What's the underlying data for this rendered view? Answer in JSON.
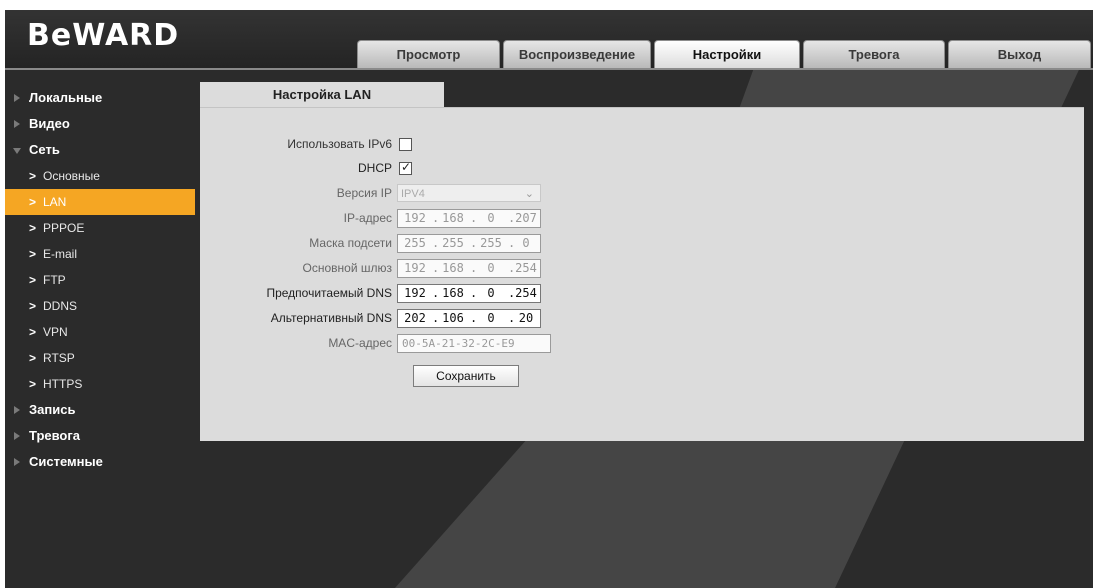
{
  "brand": "BeWARD",
  "tabs": [
    {
      "label": "Просмотр"
    },
    {
      "label": "Воспроизведение"
    },
    {
      "label": "Настройки"
    },
    {
      "label": "Тревога"
    },
    {
      "label": "Выход"
    }
  ],
  "active_tab": "Настройки",
  "sidebar": {
    "groups": [
      {
        "label": "Локальные"
      },
      {
        "label": "Видео"
      },
      {
        "label": "Сеть"
      },
      {
        "label": "Запись"
      },
      {
        "label": "Тревога"
      },
      {
        "label": "Системные"
      }
    ],
    "network_items": [
      {
        "label": "Основные"
      },
      {
        "label": "LAN"
      },
      {
        "label": "PPPOE"
      },
      {
        "label": "E-mail"
      },
      {
        "label": "FTP"
      },
      {
        "label": "DDNS"
      },
      {
        "label": "VPN"
      },
      {
        "label": "RTSP"
      },
      {
        "label": "HTTPS"
      }
    ],
    "active_item": "LAN"
  },
  "content": {
    "tab_title": "Настройка LAN",
    "use_ipv6": {
      "label": "Использовать IPv6",
      "checked": false
    },
    "dhcp": {
      "label": "DHCP",
      "checked": true
    },
    "ip_version": {
      "label": "Версия IP",
      "value": "IPV4"
    },
    "ip_address": {
      "label": "IP-адрес",
      "octets": [
        "192",
        "168",
        "0",
        "207"
      ]
    },
    "subnet_mask": {
      "label": "Маска подсети",
      "octets": [
        "255",
        "255",
        "255",
        "0"
      ]
    },
    "gateway": {
      "label": "Основной шлюз",
      "octets": [
        "192",
        "168",
        "0",
        "254"
      ]
    },
    "preferred_dns": {
      "label": "Предпочитаемый DNS",
      "octets": [
        "192",
        "168",
        "0",
        "254"
      ]
    },
    "alternate_dns": {
      "label": "Альтернативный DNS",
      "octets": [
        "202",
        "106",
        "0",
        "20"
      ]
    },
    "mac_address": {
      "label": "MAC-адрес",
      "value": "00-5A-21-32-2C-E9"
    },
    "save_label": "Сохранить",
    "check_glyph": "✓"
  },
  "icons": {
    "collapsed_arrow": "triangle-right-icon",
    "expanded_arrow": "triangle-down-icon",
    "sub_arrow": "chevron-right-icon",
    "select_arrow": "chevron-down-icon"
  },
  "colors": {
    "active_item": "#f5a623",
    "background": "#2b2b2b",
    "panel": "#dcdcdc"
  }
}
